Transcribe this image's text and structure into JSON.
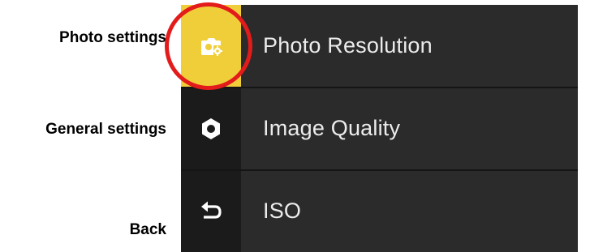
{
  "callouts": {
    "photo_settings": "Photo settings",
    "general_settings": "General settings",
    "back": "Back"
  },
  "sidebar": {
    "items": [
      {
        "icon": "photo-settings-icon",
        "active": true
      },
      {
        "icon": "gear-icon",
        "active": false
      },
      {
        "icon": "back-arrow-icon",
        "active": false
      }
    ]
  },
  "menu": {
    "items": [
      {
        "label": "Photo Resolution"
      },
      {
        "label": "Image Quality"
      },
      {
        "label": "ISO"
      }
    ]
  },
  "colors": {
    "active_tab": "#f0ce3a",
    "highlight_ring": "#e31b1b",
    "menu_bg": "#2b2b2b",
    "sidebar_bg": "#1b1b1b",
    "menu_text": "#ececec"
  }
}
